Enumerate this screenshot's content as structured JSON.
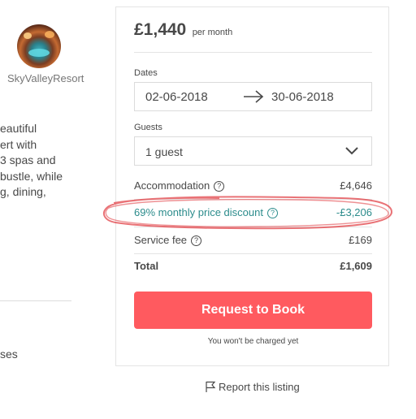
{
  "host": {
    "name": "SkyValleyResort",
    "avatar_icon": "resort-photo"
  },
  "description": {
    "lines": [
      "eautiful",
      "ert with",
      "3 spas and",
      "bustle, while",
      "g, dining,"
    ]
  },
  "left_footer": {
    "text": "ses"
  },
  "booking": {
    "price": "£1,440",
    "period": "per month",
    "dates_label": "Dates",
    "check_in": "02-06-2018",
    "check_out": "30-06-2018",
    "arrow_icon": "arrow-right-icon",
    "guests_label": "Guests",
    "guests_value": "1 guest",
    "line_items": [
      {
        "label": "Accommodation",
        "value": "£4,646",
        "help": true
      },
      {
        "label": "69% monthly price discount",
        "value": "-£3,206",
        "help": true
      },
      {
        "label": "Service fee",
        "value": "£169",
        "help": true
      }
    ],
    "total_label": "Total",
    "total_value": "£1,609",
    "book_button": "Request to Book",
    "charge_note": "You won't be charged yet",
    "help_glyph": "?"
  },
  "report": {
    "label": "Report this listing",
    "icon": "flag-icon"
  },
  "colors": {
    "accent": "#ff5a5f",
    "discount": "#2c8c8c",
    "highlight": "#e0363c"
  }
}
